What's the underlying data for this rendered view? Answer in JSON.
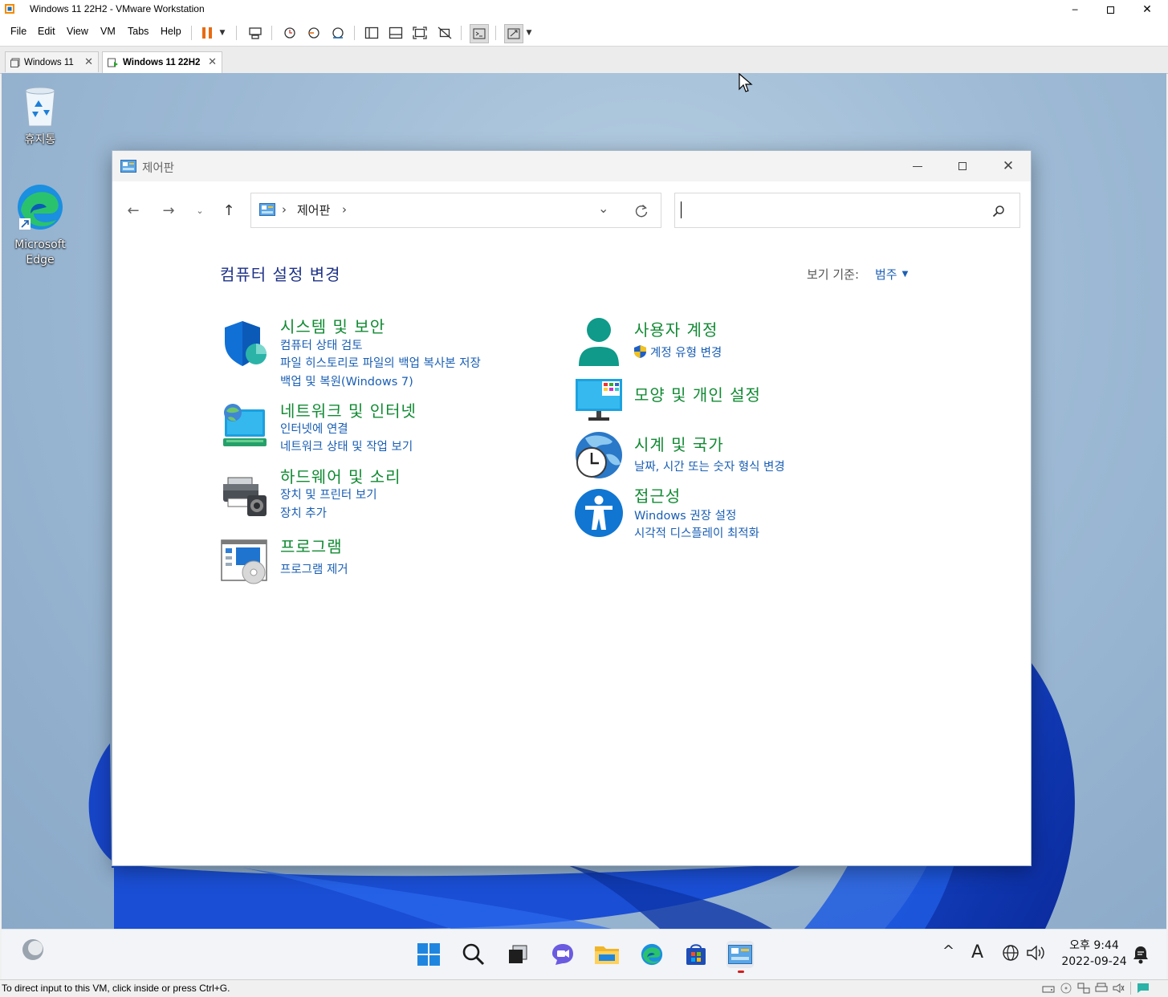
{
  "vmware": {
    "window_title": "Windows 11 22H2 - VMware Workstation",
    "menu": [
      "File",
      "Edit",
      "View",
      "VM",
      "Tabs",
      "Help"
    ],
    "tabs": [
      {
        "label": "Windows 11",
        "active": false
      },
      {
        "label": "Windows 11 22H2",
        "active": true
      }
    ],
    "status_message": "To direct input to this VM, click inside or press Ctrl+G."
  },
  "desktop": {
    "icons": [
      {
        "label": "휴지통",
        "icon": "recycle-bin-icon"
      },
      {
        "label": "Microsoft Edge",
        "icon": "edge-icon"
      }
    ]
  },
  "control_panel": {
    "window_title": "제어판",
    "address": {
      "crumb": "제어판",
      "separator": "›"
    },
    "search": {
      "value": "",
      "placeholder": ""
    },
    "heading": "컴퓨터 설정 변경",
    "view_by_label": "보기 기준:",
    "view_by_value": "범주",
    "categories": [
      {
        "title": "시스템 및 보안",
        "links": [
          "컴퓨터 상태 검토",
          "파일 히스토리로 파일의 백업 복사본 저장",
          "백업 및 복원(Windows 7)"
        ]
      },
      {
        "title": "네트워크 및 인터넷",
        "links": [
          "인터넷에 연결",
          "네트워크 상태 및 작업 보기"
        ]
      },
      {
        "title": "하드웨어 및 소리",
        "links": [
          "장치 및 프린터 보기",
          "장치 추가"
        ]
      },
      {
        "title": "프로그램",
        "links": [
          "프로그램 제거"
        ]
      },
      {
        "title": "사용자 계정",
        "links": [
          "계정 유형 변경"
        ]
      },
      {
        "title": "모양 및 개인 설정",
        "links": []
      },
      {
        "title": "시계 및 국가",
        "links": [
          "날짜, 시간 또는 숫자 형식 변경"
        ]
      },
      {
        "title": "접근성",
        "links": [
          "Windows 권장 설정",
          "시각적 디스플레이 최적화"
        ]
      }
    ]
  },
  "taskbar": {
    "clock_time": "오후 9:44",
    "clock_date": "2022-09-24",
    "ime": "A",
    "apps": [
      "start",
      "search",
      "task-view",
      "chat",
      "file-explorer",
      "edge",
      "store",
      "control-panel"
    ]
  },
  "colors": {
    "category_title": "#118a33",
    "link": "#1a5fb4",
    "heading": "#1e3287",
    "accent": "#0067c0"
  }
}
